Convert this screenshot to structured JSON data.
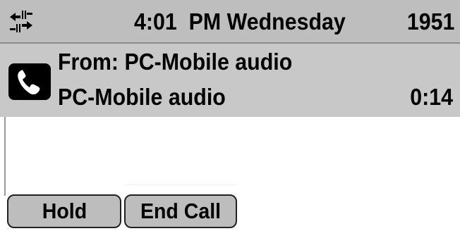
{
  "status_bar": {
    "network_icon": "network-transfer-icon",
    "time": "4:01  PM Wednesday",
    "extension": "1951"
  },
  "call": {
    "from_line": "From: PC-Mobile audio",
    "name": "PC-Mobile audio",
    "duration": "0:14",
    "icon": "phone-handset-icon"
  },
  "softkeys": [
    {
      "label": "Hold"
    },
    {
      "label": "End Call"
    }
  ],
  "colors": {
    "status_bar_bg": "#bebebe",
    "call_panel_bg": "#c8c8c8",
    "softkey_bg": "#bdbdbd",
    "text": "#000000"
  }
}
